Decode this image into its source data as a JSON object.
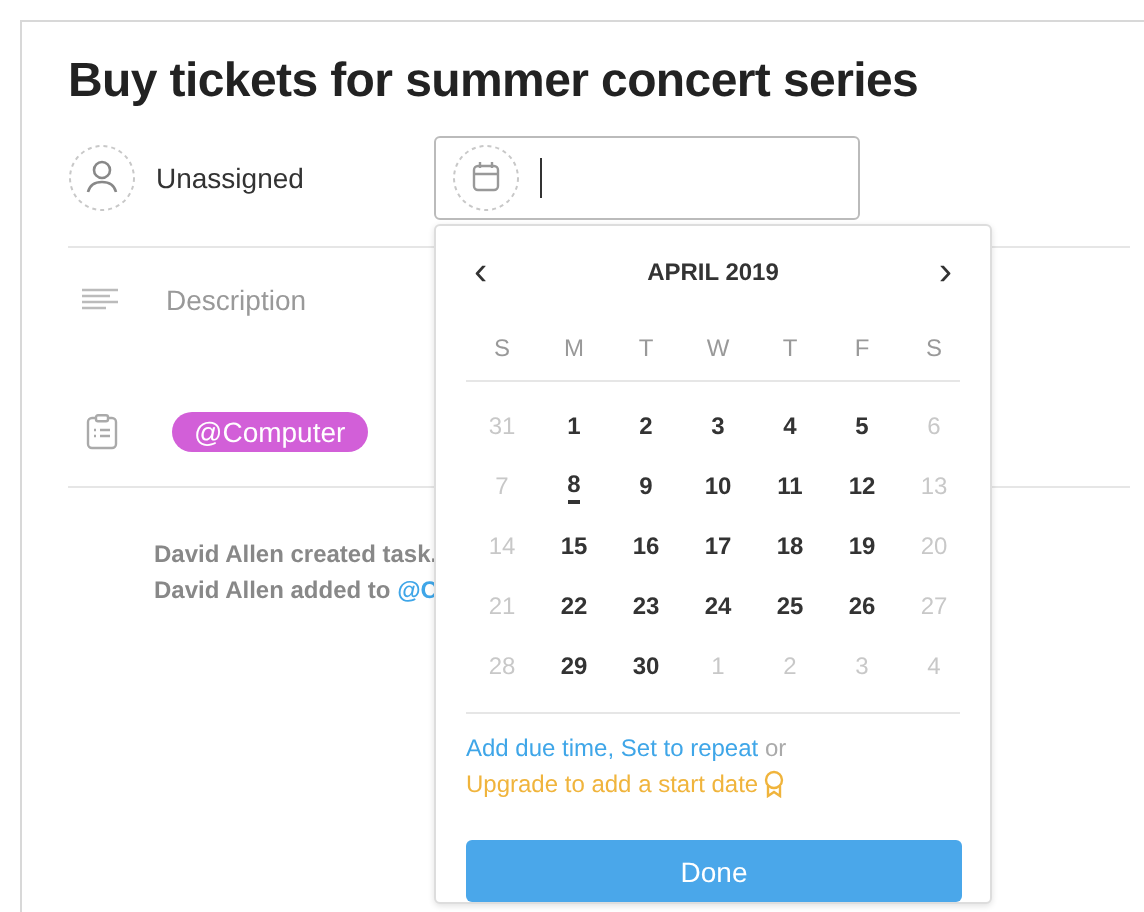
{
  "task": {
    "title": "Buy tickets for summer concert series",
    "assignee": "Unassigned",
    "description_placeholder": "Description",
    "tag": {
      "label": "@Computer",
      "color": "#d25fd8"
    }
  },
  "activity": [
    {
      "text": "David Allen created task."
    },
    {
      "text": "David Allen added to ",
      "link": "@C"
    }
  ],
  "date_picker": {
    "month": "APRIL 2019",
    "prev": "‹",
    "next": "›",
    "weekdays": [
      "S",
      "M",
      "T",
      "W",
      "T",
      "F",
      "S"
    ],
    "weeks": [
      [
        {
          "label": "31",
          "outside": true,
          "today": false
        },
        {
          "label": "1",
          "outside": false,
          "today": false
        },
        {
          "label": "2",
          "outside": false,
          "today": false
        },
        {
          "label": "3",
          "outside": false,
          "today": false
        },
        {
          "label": "4",
          "outside": false,
          "today": false
        },
        {
          "label": "5",
          "outside": false,
          "today": false
        },
        {
          "label": "6",
          "outside": true,
          "today": false
        }
      ],
      [
        {
          "label": "7",
          "outside": true,
          "today": false
        },
        {
          "label": "8",
          "outside": false,
          "today": true
        },
        {
          "label": "9",
          "outside": false,
          "today": false
        },
        {
          "label": "10",
          "outside": false,
          "today": false
        },
        {
          "label": "11",
          "outside": false,
          "today": false
        },
        {
          "label": "12",
          "outside": false,
          "today": false
        },
        {
          "label": "13",
          "outside": true,
          "today": false
        }
      ],
      [
        {
          "label": "14",
          "outside": true,
          "today": false
        },
        {
          "label": "15",
          "outside": false,
          "today": false
        },
        {
          "label": "16",
          "outside": false,
          "today": false
        },
        {
          "label": "17",
          "outside": false,
          "today": false
        },
        {
          "label": "18",
          "outside": false,
          "today": false
        },
        {
          "label": "19",
          "outside": false,
          "today": false
        },
        {
          "label": "20",
          "outside": true,
          "today": false
        }
      ],
      [
        {
          "label": "21",
          "outside": true,
          "today": false
        },
        {
          "label": "22",
          "outside": false,
          "today": false
        },
        {
          "label": "23",
          "outside": false,
          "today": false
        },
        {
          "label": "24",
          "outside": false,
          "today": false
        },
        {
          "label": "25",
          "outside": false,
          "today": false
        },
        {
          "label": "26",
          "outside": false,
          "today": false
        },
        {
          "label": "27",
          "outside": true,
          "today": false
        }
      ],
      [
        {
          "label": "28",
          "outside": true,
          "today": false
        },
        {
          "label": "29",
          "outside": false,
          "today": false
        },
        {
          "label": "30",
          "outside": false,
          "today": false
        },
        {
          "label": "1",
          "outside": true,
          "today": false
        },
        {
          "label": "2",
          "outside": true,
          "today": false
        },
        {
          "label": "3",
          "outside": true,
          "today": false
        },
        {
          "label": "4",
          "outside": true,
          "today": false
        }
      ]
    ],
    "links": [
      "Add due time",
      ", ",
      "Set to repeat",
      " or"
    ],
    "upgrade": "Upgrade to add a start date",
    "done_button": "Done"
  }
}
